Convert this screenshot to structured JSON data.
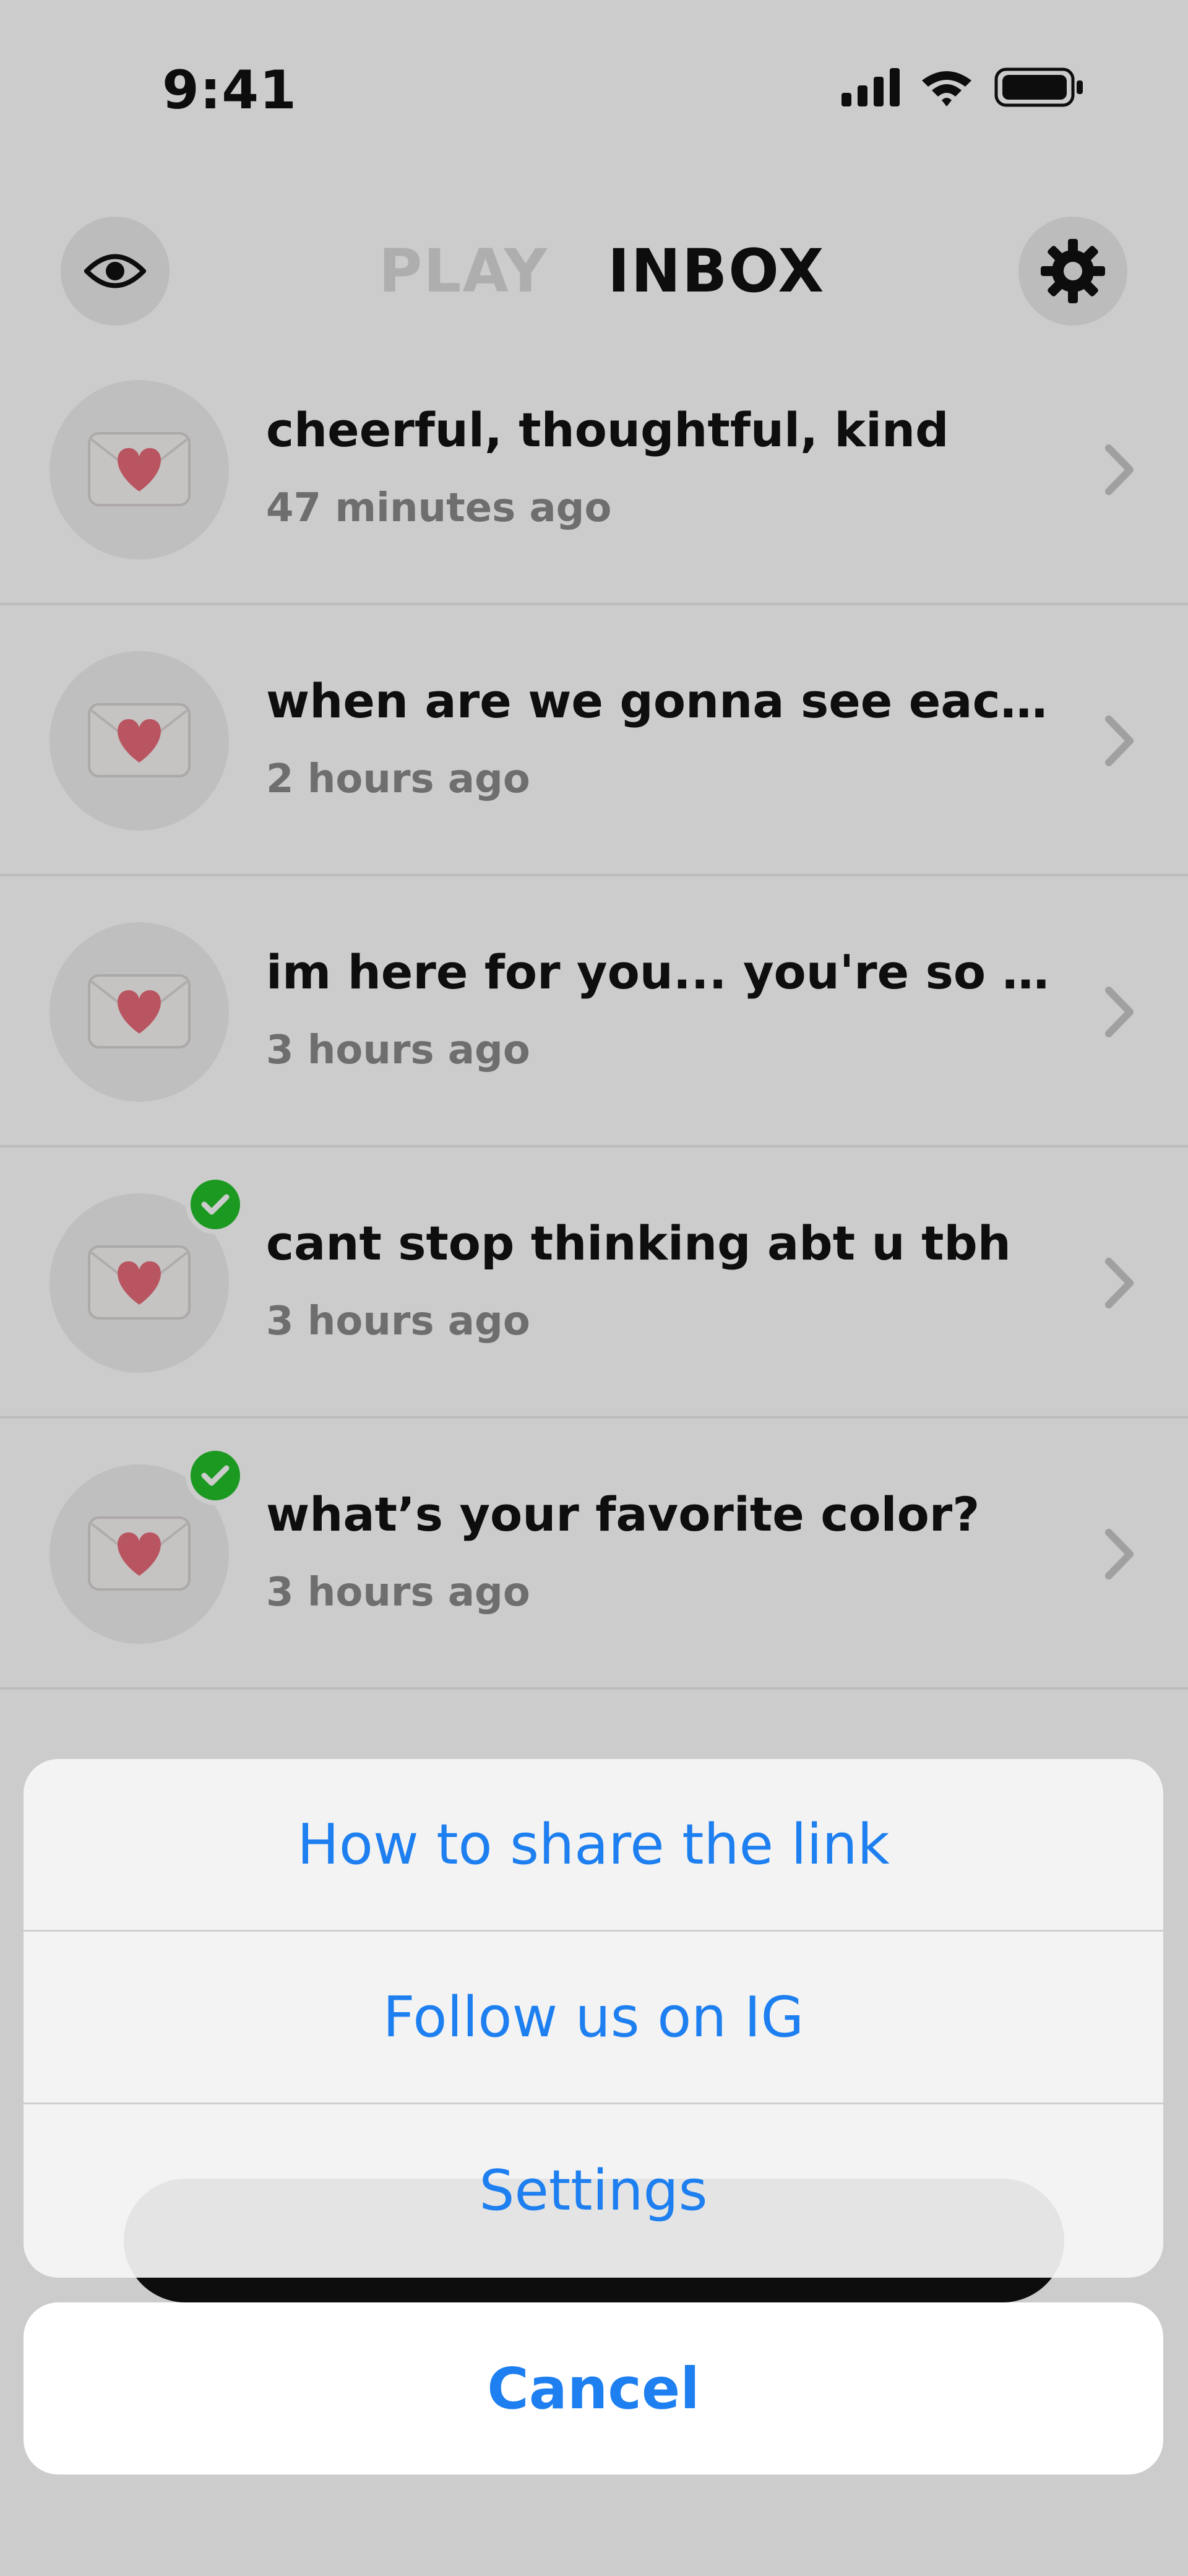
{
  "status_bar": {
    "time": "9:41"
  },
  "header": {
    "tabs": [
      {
        "label": "PLAY",
        "active": false
      },
      {
        "label": "INBOX",
        "active": true
      }
    ],
    "left_icon": "eye-icon",
    "right_icon": "gear-icon"
  },
  "inbox": {
    "items": [
      {
        "title": "cheerful, thoughtful, kind",
        "time": "47 minutes ago",
        "checked": false
      },
      {
        "title": "when are we gonna see each oth...",
        "time": "2 hours ago",
        "checked": false
      },
      {
        "title": "im here for you... you're so speci...",
        "time": "3 hours ago",
        "checked": false
      },
      {
        "title": "cant stop thinking abt u tbh",
        "time": "3 hours ago",
        "checked": true
      },
      {
        "title": "what’s your favorite color?",
        "time": "3 hours ago",
        "checked": true
      }
    ]
  },
  "action_sheet": {
    "options": [
      {
        "label": "How to share the link"
      },
      {
        "label": "Follow us on IG"
      },
      {
        "label": "Settings"
      }
    ],
    "cancel_label": "Cancel"
  },
  "colors": {
    "accent": "#1d7ff0",
    "check": "#22c02a",
    "heart": "#e86b7a"
  }
}
